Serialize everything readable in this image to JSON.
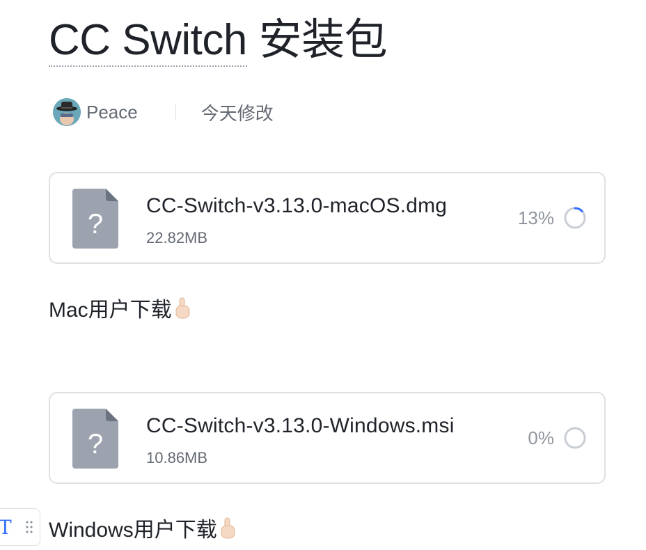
{
  "document": {
    "title_linked": "CC Switch",
    "title_rest": " 安装包"
  },
  "meta": {
    "author": "Peace",
    "modified": "今天修改"
  },
  "files": [
    {
      "name": "CC-Switch-v3.13.0-macOS.dmg",
      "size": "22.82MB",
      "progress_text": "13%",
      "progress": 0.13,
      "icon": "unknown-file-icon"
    },
    {
      "name": "CC-Switch-v3.13.0-Windows.msi",
      "size": "10.86MB",
      "progress_text": "0%",
      "progress": 0,
      "icon": "unknown-file-icon"
    }
  ],
  "paragraphs": {
    "mac_text": "Mac用户下载",
    "windows_text": "Windows用户下载"
  },
  "colors": {
    "progress_accent": "#3370ff",
    "progress_track": "#c9cdd4",
    "file_icon": "#9ca3af"
  }
}
